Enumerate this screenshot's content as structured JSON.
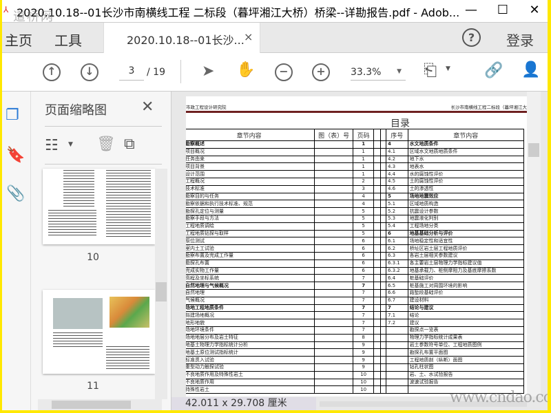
{
  "window": {
    "title": "2020.10.18--01长沙市南横线工程 二标段（暮坪湘江大桥）桥梁--详勘报告.pdf - Adob...",
    "watermark_top": "道桥网",
    "watermark_bottom": "www.cndao.com",
    "minimize": "—",
    "maximize": "☐",
    "close": "✕"
  },
  "menu": {
    "home": "主页",
    "tools": "工具",
    "tab_label": "2020.10.18--01长沙...",
    "tab_close": "×",
    "help": "?",
    "login": "登录"
  },
  "toolbar": {
    "current_page": "3",
    "total_pages": "/ 19",
    "zoom": "33.3%",
    "icons": [
      "arrow-up-circle",
      "arrow-down-circle",
      "select-cursor",
      "hand-tool",
      "zoom-out",
      "zoom-in",
      "page-fit",
      "link-cloud",
      "add-user"
    ]
  },
  "sidebar": {
    "title": "页面缩略图",
    "close": "✕",
    "thumbnails": [
      {
        "page": "10"
      },
      {
        "page": "11"
      }
    ]
  },
  "document": {
    "header_left": "市政工程设计研究院",
    "header_right": "长沙市南横线工程二标段（暮坪湘江大",
    "toc_title": "目录",
    "left_headers": [
      "章节内容",
      "图（表）号",
      "页码"
    ],
    "right_headers": [
      "序号",
      "章节内容"
    ],
    "left_rows": [
      {
        "t": "勘察概述",
        "p": "1",
        "b": true
      },
      {
        "t": "项目概况",
        "p": "1"
      },
      {
        "t": "任务由来",
        "p": "1"
      },
      {
        "t": "项目背景",
        "p": "1"
      },
      {
        "t": "设计范围",
        "p": "1"
      },
      {
        "t": "工程概况",
        "p": "2"
      },
      {
        "t": "技术标准",
        "p": "3"
      },
      {
        "t": "勘察目的与任务",
        "p": "4"
      },
      {
        "t": "勘察依据和执行技术标准、规范",
        "p": "4"
      },
      {
        "t": "勘探孔定位与测量",
        "p": "5"
      },
      {
        "t": "勘察手段与方法",
        "p": "5"
      },
      {
        "t": "工程地质调绘",
        "p": "5"
      },
      {
        "t": "工程地质钻探与取样",
        "p": "5"
      },
      {
        "t": "原位测试",
        "p": "6"
      },
      {
        "t": "室内土工试验",
        "p": "6"
      },
      {
        "t": "勘察布置及完成工作量",
        "p": "6"
      },
      {
        "t": "勘探孔布置",
        "p": "6"
      },
      {
        "t": "完成实物工作量",
        "p": "6"
      },
      {
        "t": "高程及坐标系统",
        "p": "7"
      },
      {
        "t": "自然地理与气候概况",
        "p": "7",
        "b": true
      },
      {
        "t": "自然地理",
        "p": "7"
      },
      {
        "t": "气候概况",
        "p": "7"
      },
      {
        "t": "场地工程地质条件",
        "p": "7",
        "b": true
      },
      {
        "t": "拟建场地概况",
        "p": "7"
      },
      {
        "t": "地形地貌",
        "p": "7"
      },
      {
        "t": "场地环境条件",
        "p": "7"
      },
      {
        "t": "场地地层分布及岩土特征",
        "p": "8"
      },
      {
        "t": "地基土物理力学指标统计分析",
        "p": "9"
      },
      {
        "t": "地基土原位测试指标统计",
        "p": "9"
      },
      {
        "t": "标准贯入试验",
        "p": "9"
      },
      {
        "t": "重型动力触探试验",
        "p": "9"
      },
      {
        "t": "不良地质作用及特殊性岩土",
        "p": "10"
      },
      {
        "t": "不良地质作用",
        "p": "10"
      },
      {
        "t": "特殊性岩土",
        "p": "10"
      }
    ],
    "right_rows": [
      {
        "n": "4",
        "t": "水文地质条件",
        "b": true
      },
      {
        "n": "4.1",
        "t": "区域水文地质地质条件"
      },
      {
        "n": "4.2",
        "t": "地下水"
      },
      {
        "n": "4.3",
        "t": "地表水"
      },
      {
        "n": "4.4",
        "t": "水的腐蚀性评价"
      },
      {
        "n": "4.5",
        "t": "土的腐蚀性评价"
      },
      {
        "n": "4.6",
        "t": "土的渗透性"
      },
      {
        "n": "5",
        "t": "场地地震效应",
        "b": true
      },
      {
        "n": "5.1",
        "t": "区域地质构造"
      },
      {
        "n": "5.2",
        "t": "抗震设计参数"
      },
      {
        "n": "5.3",
        "t": "地震液化判别"
      },
      {
        "n": "5.4",
        "t": "工程场地分类"
      },
      {
        "n": "6",
        "t": "地基基础分析与评价",
        "b": true
      },
      {
        "n": "6.1",
        "t": "场地稳定性和适宜性"
      },
      {
        "n": "6.2",
        "t": "桥址区岩土层工程地质评价"
      },
      {
        "n": "6.3",
        "t": "各岩土层相关参数建议"
      },
      {
        "n": "6.3.1",
        "t": "各主要岩土层物理力学指标建议值"
      },
      {
        "n": "6.3.2",
        "t": "地基承载力、桩侧摩阻力及基底摩擦系数"
      },
      {
        "n": "6.4",
        "t": "桩基础评价"
      },
      {
        "n": "6.5",
        "t": "桩基施工对周围环境的影响"
      },
      {
        "n": "6.6",
        "t": "路堑段基础评价"
      },
      {
        "n": "6.7",
        "t": "建设材料"
      },
      {
        "n": "7",
        "t": "结论与建议",
        "b": true
      },
      {
        "n": "7.1",
        "t": "结论"
      },
      {
        "n": "7.2",
        "t": "建议"
      },
      {
        "n": "",
        "t": "勘探点一览表"
      },
      {
        "n": "",
        "t": "物理力学指标统计成果表"
      },
      {
        "n": "",
        "t": "岩土参数符号单位、工程地质图例"
      },
      {
        "n": "",
        "t": "勘探孔布置平面图"
      },
      {
        "n": "",
        "t": "工程地质剖（纵断）面图"
      },
      {
        "n": "",
        "t": "钻孔柱状图"
      },
      {
        "n": "",
        "t": "岩、土、水试验报告"
      },
      {
        "n": "",
        "t": "波速试验报告"
      },
      {
        "n": "",
        "t": ""
      }
    ]
  },
  "status": {
    "page_size": "42.011 x 29.708 厘米"
  },
  "colors": {
    "accent": "#2a7ad5",
    "header_rule": "#6e2020",
    "window_border": "#ffe800"
  }
}
